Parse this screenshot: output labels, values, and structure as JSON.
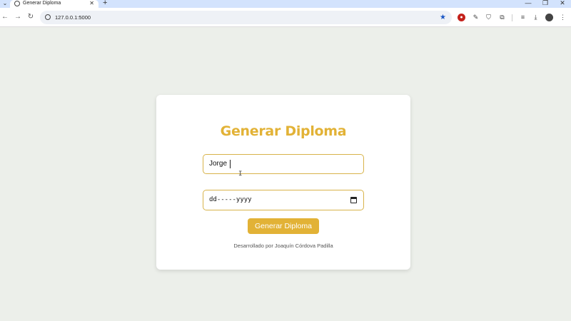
{
  "browser": {
    "tab_title": "Generar Diploma",
    "tab_close": "✕",
    "new_tab": "+",
    "menu": "⌄",
    "url": "127.0.0.1:5000",
    "window_controls": {
      "minimize": "—",
      "restore": "❐",
      "close": "✕"
    },
    "nav": {
      "back": "←",
      "forward": "→",
      "reload": "↻"
    },
    "icons": [
      "info-icon",
      "bookmark-star-icon",
      "extension-icon",
      "pen-icon",
      "shield-icon",
      "puzzle-icon",
      "media-icon",
      "download-icon",
      "profile-avatar-icon",
      "menu-dots-icon"
    ]
  },
  "form": {
    "title": "Generar Diploma",
    "name_value": "Jorge",
    "date_placeholder": "dd-----yyyy",
    "submit_label": "Generar Diploma",
    "footer": "Desarrollado por Joaquín Córdova Padilla"
  },
  "colors": {
    "accent": "#e2b236",
    "background": "#ecefea",
    "card": "#ffffff"
  }
}
